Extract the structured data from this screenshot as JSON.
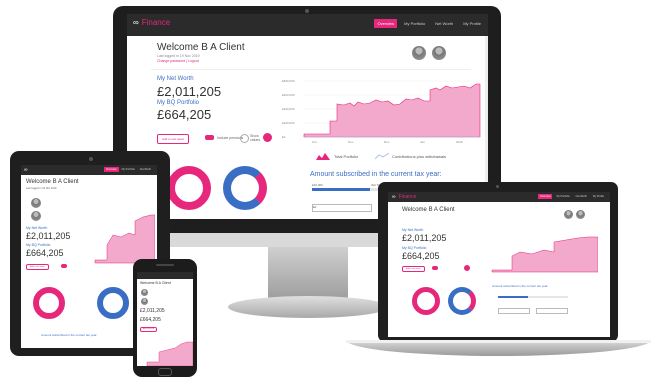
{
  "app": {
    "logo": "Finance",
    "nav": [
      "Overview",
      "My Portfolio",
      "Net Worth",
      "My Profile"
    ],
    "active_nav": 0
  },
  "welcome": {
    "title": "Welcome B A Client",
    "last_logged": "Last logged in 19 Nov 2019",
    "logout": "Change password | Logout"
  },
  "net_worth": {
    "label": "My Net Worth",
    "value": "£2,011,205"
  },
  "portfolio": {
    "label": "My BQ Portfolio",
    "value": "£664,205"
  },
  "controls": {
    "button": "Add a new asset",
    "opt1": "Include pensions",
    "opt2": "Show values"
  },
  "chart": {
    "y_ticks": [
      "£800,000",
      "£600,000",
      "£400,000",
      "£200,000",
      "£0"
    ],
    "x_ticks": [
      "Oct",
      "Nov",
      "Dec",
      "Jan",
      "2019"
    ],
    "legend1": "Total Portfolio",
    "legend2": "Contributions plus withdrawals"
  },
  "tax": {
    "title": "Amount subscribed in the current tax year:",
    "amount_left": "£20,000",
    "amount_right": "ISA Total",
    "field1": "£0",
    "field2": "£0"
  },
  "phone": {
    "title": "Welcome B A Client",
    "nw": "£2,011,205",
    "bq": "£664,205"
  },
  "colors": {
    "brand": "#e6277b",
    "accent": "#3a6ec5",
    "dark": "#2b2b2b"
  }
}
